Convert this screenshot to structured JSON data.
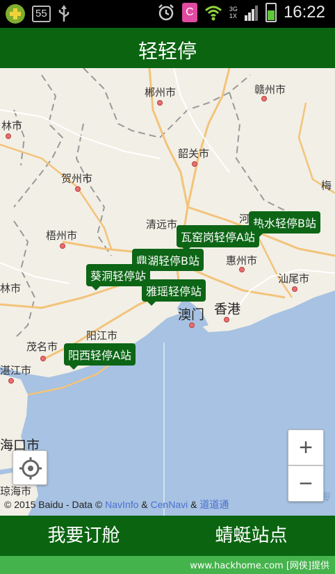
{
  "status_bar": {
    "badge": "55",
    "network": "3G\n1X",
    "c_icon": "C",
    "time": "16:22"
  },
  "app_title": "轻轻停",
  "map": {
    "cities": {
      "chenzhou": "郴州市",
      "ganzhou": "赣州市",
      "linshi": "林市",
      "shaoguan": "韶关市",
      "hezhou": "贺州市",
      "meizhou": "梅",
      "wuzhou": "梧州市",
      "qingyuan": "清远市",
      "he": "河",
      "huizhou": "惠州市",
      "shanwei": "汕尾市",
      "linshi2": "林市",
      "macau": "澳门",
      "hongkong": "香港",
      "yangjiang": "阳江市",
      "maoming": "茂名市",
      "zhanjiang": "湛江市",
      "haikou": "海口市",
      "qionghai": "琼海市",
      "nanhai": "南海"
    },
    "stations": {
      "reshui": "热水轻停B站",
      "wayaogang": "瓦窑岗轻停A站",
      "dinghu": "鼎湖轻停B站",
      "kuidong": "葵洞轻停站",
      "yayao": "雅瑶轻停站",
      "yangxi": "阳西轻停A站"
    },
    "zoom_in": "+",
    "zoom_out": "−",
    "copyright": {
      "prefix": "© 2015 Baidu - Data ©",
      "navinfo": "NavInfo",
      "amp1": "&",
      "cennavi": "CenNavi",
      "amp2": "&",
      "daodaotong": "道道通"
    }
  },
  "bottom": {
    "book": "我要订舱",
    "stations": "蜻蜓站点"
  },
  "watermark": "www.hackhome.com [网侠]提供",
  "colors": {
    "brand_green": "#0a6410",
    "station_green": "#0d6516",
    "sea": "#a7c2e2",
    "land": "#f2efe6"
  }
}
